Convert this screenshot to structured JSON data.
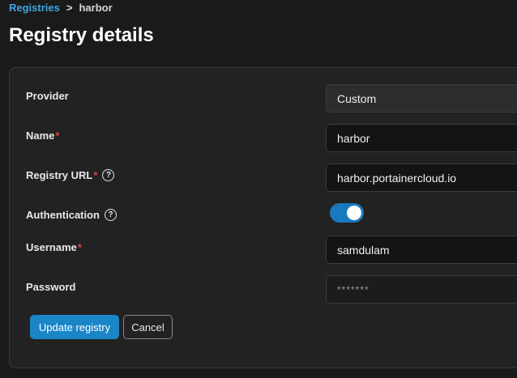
{
  "breadcrumb": {
    "root": "Registries",
    "separator": ">",
    "current": "harbor"
  },
  "page": {
    "title": "Registry details"
  },
  "form": {
    "provider": {
      "label": "Provider",
      "value": "Custom"
    },
    "name": {
      "label": "Name",
      "required": "*",
      "value": "harbor"
    },
    "registry_url": {
      "label": "Registry URL",
      "required": "*",
      "value": "harbor.portainercloud.io",
      "help": "?"
    },
    "authentication": {
      "label": "Authentication",
      "help": "?",
      "enabled": true
    },
    "username": {
      "label": "Username",
      "required": "*",
      "value": "samdulam"
    },
    "password": {
      "label": "Password",
      "value": "*******"
    }
  },
  "actions": {
    "update_label": "Update registry",
    "cancel_label": "Cancel"
  },
  "colors": {
    "accent": "#1a86c8",
    "link": "#3ea6e3",
    "required": "#e0403a"
  }
}
